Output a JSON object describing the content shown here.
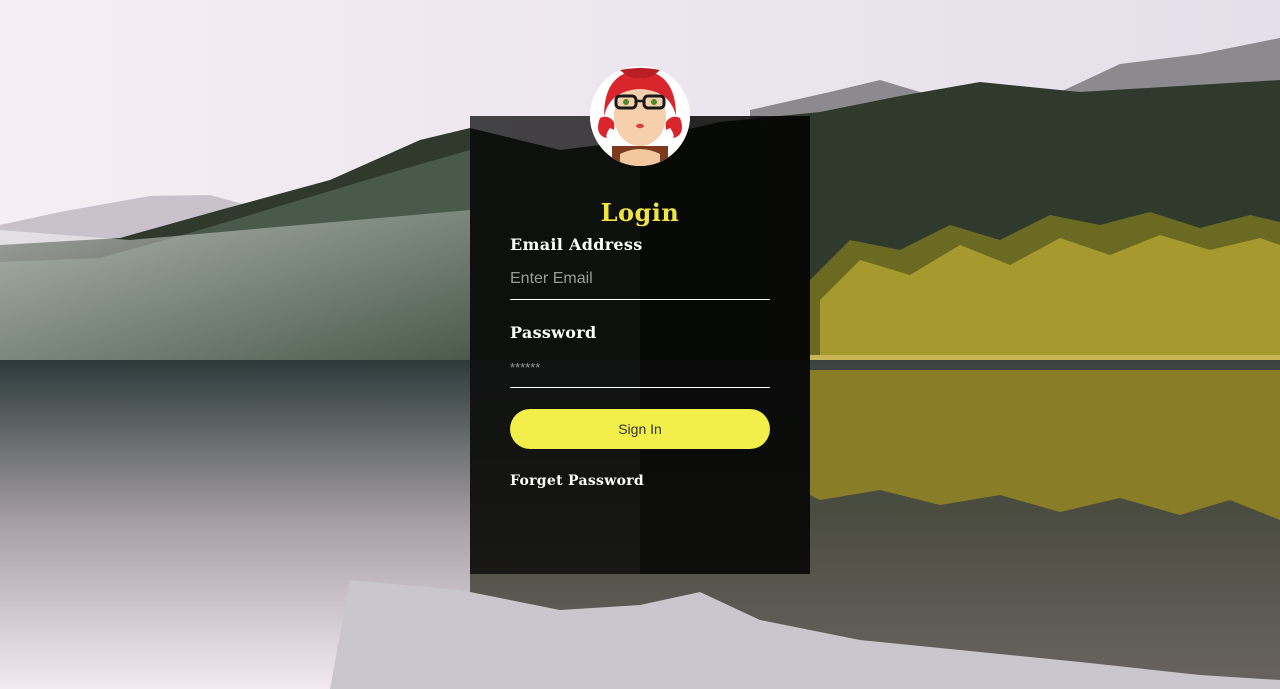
{
  "login": {
    "title": "Login",
    "email_label": "Email Address",
    "email_placeholder": "Enter Email",
    "password_label": "Password",
    "password_placeholder": "******",
    "signin_label": "Sign In",
    "forget_label": "Forget Password"
  },
  "colors": {
    "accent": "#f2ee4a",
    "title": "#f0e442",
    "panel": "#000000"
  },
  "icons": {
    "avatar": "avatar-woman-red-hair-glasses"
  }
}
